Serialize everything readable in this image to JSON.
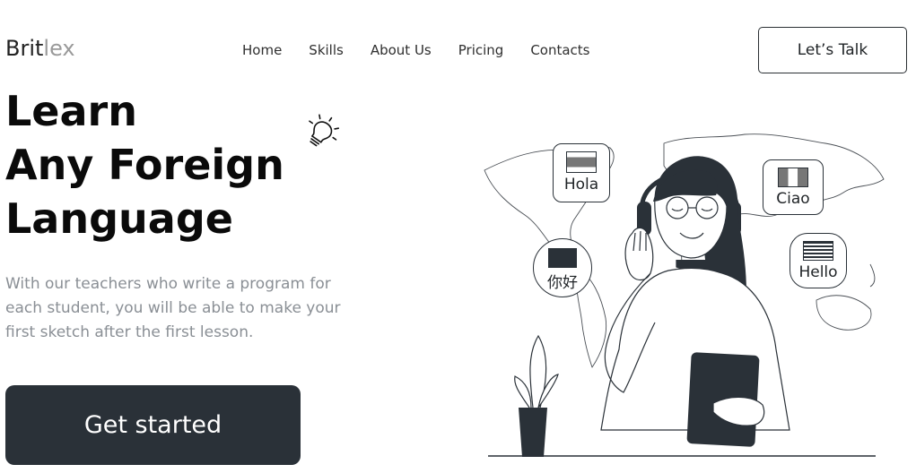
{
  "brand": {
    "part1": "Brit",
    "part2": "lex"
  },
  "nav": {
    "items": [
      {
        "label": "Home"
      },
      {
        "label": "Skills"
      },
      {
        "label": "About Us"
      },
      {
        "label": "Pricing"
      },
      {
        "label": "Contacts"
      }
    ],
    "cta_label": "Let’s Talk"
  },
  "hero": {
    "title_lines": [
      "Learn",
      "Any Foreign",
      "Language"
    ],
    "subtitle": "With our teachers who write a program for each student, you will be able to make your first sketch after the first lesson.",
    "cta_label": "Get started"
  },
  "illustration": {
    "bubbles": [
      {
        "text": "Hola",
        "flag": "flag-spain-icon"
      },
      {
        "text": "Ciao",
        "flag": "flag-italy-icon"
      },
      {
        "text": "你好",
        "flag": "flag-china-icon"
      },
      {
        "text": "Hello",
        "flag": "flag-usa-icon"
      }
    ]
  },
  "colors": {
    "accent_dark": "#2a3138",
    "logo_muted": "#9a9a9a",
    "subtitle_gray": "#8a8f95"
  }
}
